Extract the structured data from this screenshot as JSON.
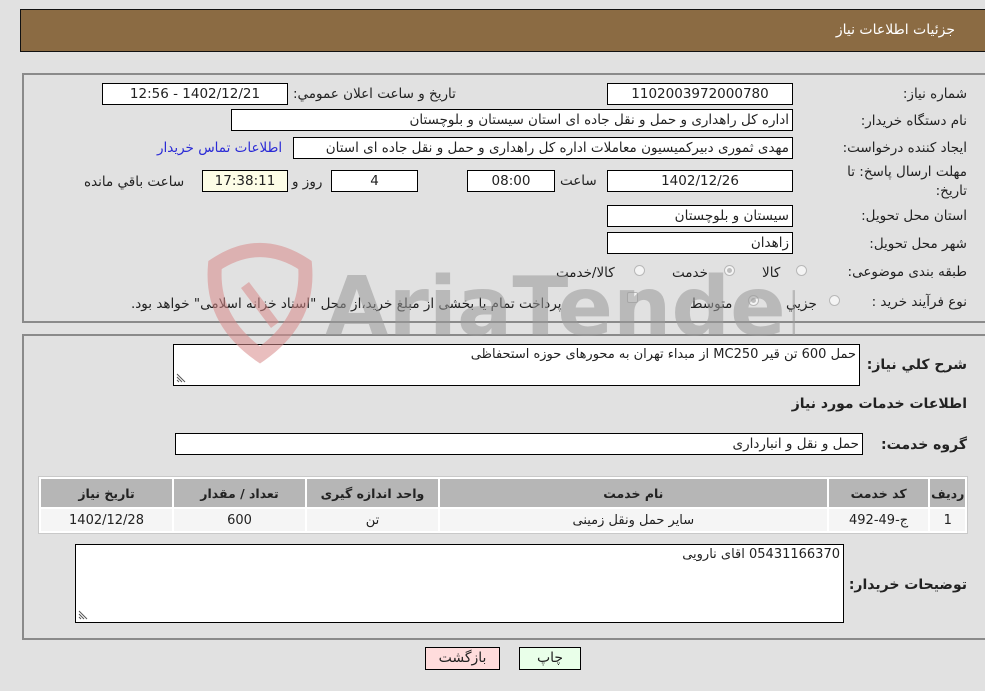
{
  "header": {
    "title": "جزئیات اطلاعات نیاز"
  },
  "fields": {
    "need_number": {
      "label": "شماره نیاز:",
      "value": "1102003972000780"
    },
    "announce_datetime": {
      "label": "تاريخ و ساعت اعلان عمومي:",
      "value": "1402/12/21 - 12:56"
    },
    "buyer_org": {
      "label": "نام دستگاه خريدار:",
      "value": "اداره کل راهداری و حمل و نقل جاده ای استان سیستان و بلوچستان"
    },
    "requester": {
      "label": "ايجاد کننده درخواست:",
      "value": "مهدی ثموری دبیرکمیسیون معاملات اداره کل راهداری و حمل و نقل جاده ای استان"
    },
    "contact_link": "اطلاعات تماس خريدار",
    "deadline": {
      "label_line1": "مهلت ارسال پاسخ: تا",
      "label_line2": "تاريخ:",
      "date": "1402/12/26",
      "time_label": "ساعت",
      "time": "08:00",
      "days": "4",
      "days_label": "روز و",
      "remaining": "17:38:11",
      "remaining_label": "ساعت باقي مانده"
    },
    "delivery_province": {
      "label": "استان محل تحويل:",
      "value": "سیستان و بلوچستان"
    },
    "delivery_city": {
      "label": "شهر محل تحويل:",
      "value": "زاهدان"
    },
    "category": {
      "label": "طبقه بندی موضوعی:",
      "options": [
        "کالا",
        "خدمت",
        "کالا/خدمت"
      ],
      "selected": "خدمت"
    },
    "purchase_type": {
      "label": "نوع فرآيند خريد :",
      "options": [
        "جزيي",
        "متوسط"
      ],
      "selected": "متوسط",
      "treasury_checkbox_text": "پرداخت تمام يا بخشی از مبلغ خريد،از محل \"اسناد خزانه اسلامی\" خواهد بود.",
      "treasury_checked": false
    }
  },
  "description": {
    "label": "شرح کلي نياز:",
    "value": "حمل 600 تن قیر MC250  از مبداء تهران به محورهای حوزه استحفاظی"
  },
  "services": {
    "section_title": "اطلاعات خدمات مورد نياز",
    "group_label": "گروه خدمت:",
    "group_value": "حمل و نقل و انبارداری",
    "table": {
      "headers": [
        "رديف",
        "کد خدمت",
        "نام خدمت",
        "واحد اندازه گيری",
        "تعداد / مقدار",
        "تاريخ نياز"
      ],
      "rows": [
        [
          "1",
          "ج-49-492",
          "سایر حمل ونقل زمینی",
          "تن",
          "600",
          "1402/12/28"
        ]
      ]
    }
  },
  "buyer_notes": {
    "label": "توضيحات خريدار:",
    "value": "05431166370 اقای نارویی"
  },
  "buttons": {
    "print": "چاپ",
    "back": "بازگشت"
  },
  "watermark": {
    "text": "AriaTender.neT"
  },
  "colors": {
    "header_bg": "#8b6b43",
    "print_bg": "#e9ffe9",
    "back_bg": "#ffdcdc",
    "link": "#2a2ad6"
  }
}
